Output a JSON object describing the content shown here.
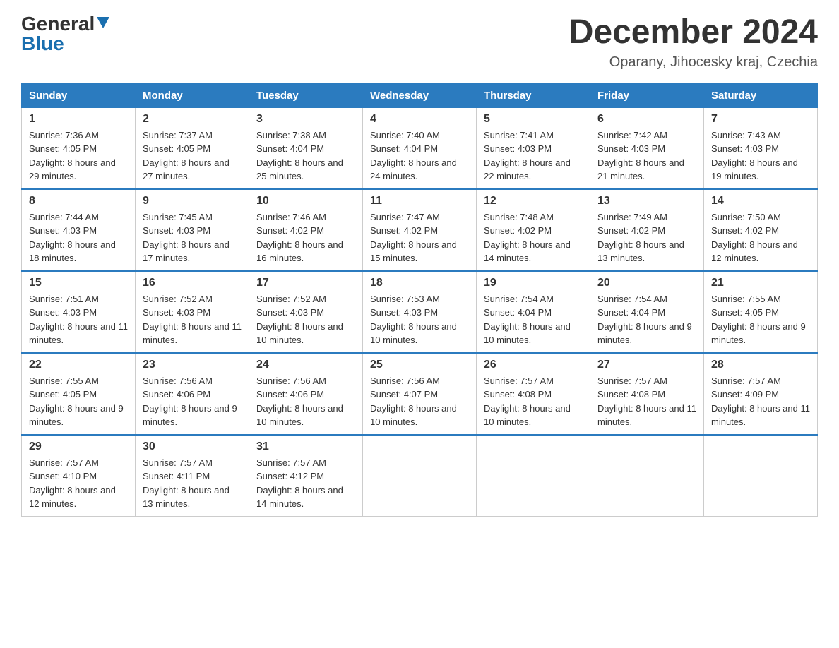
{
  "header": {
    "logo_general": "General",
    "logo_blue": "Blue",
    "month_year": "December 2024",
    "location": "Oparany, Jihocesky kraj, Czechia"
  },
  "days_of_week": [
    "Sunday",
    "Monday",
    "Tuesday",
    "Wednesday",
    "Thursday",
    "Friday",
    "Saturday"
  ],
  "weeks": [
    [
      {
        "day": "1",
        "sunrise": "7:36 AM",
        "sunset": "4:05 PM",
        "daylight": "8 hours and 29 minutes."
      },
      {
        "day": "2",
        "sunrise": "7:37 AM",
        "sunset": "4:05 PM",
        "daylight": "8 hours and 27 minutes."
      },
      {
        "day": "3",
        "sunrise": "7:38 AM",
        "sunset": "4:04 PM",
        "daylight": "8 hours and 25 minutes."
      },
      {
        "day": "4",
        "sunrise": "7:40 AM",
        "sunset": "4:04 PM",
        "daylight": "8 hours and 24 minutes."
      },
      {
        "day": "5",
        "sunrise": "7:41 AM",
        "sunset": "4:03 PM",
        "daylight": "8 hours and 22 minutes."
      },
      {
        "day": "6",
        "sunrise": "7:42 AM",
        "sunset": "4:03 PM",
        "daylight": "8 hours and 21 minutes."
      },
      {
        "day": "7",
        "sunrise": "7:43 AM",
        "sunset": "4:03 PM",
        "daylight": "8 hours and 19 minutes."
      }
    ],
    [
      {
        "day": "8",
        "sunrise": "7:44 AM",
        "sunset": "4:03 PM",
        "daylight": "8 hours and 18 minutes."
      },
      {
        "day": "9",
        "sunrise": "7:45 AM",
        "sunset": "4:03 PM",
        "daylight": "8 hours and 17 minutes."
      },
      {
        "day": "10",
        "sunrise": "7:46 AM",
        "sunset": "4:02 PM",
        "daylight": "8 hours and 16 minutes."
      },
      {
        "day": "11",
        "sunrise": "7:47 AM",
        "sunset": "4:02 PM",
        "daylight": "8 hours and 15 minutes."
      },
      {
        "day": "12",
        "sunrise": "7:48 AM",
        "sunset": "4:02 PM",
        "daylight": "8 hours and 14 minutes."
      },
      {
        "day": "13",
        "sunrise": "7:49 AM",
        "sunset": "4:02 PM",
        "daylight": "8 hours and 13 minutes."
      },
      {
        "day": "14",
        "sunrise": "7:50 AM",
        "sunset": "4:02 PM",
        "daylight": "8 hours and 12 minutes."
      }
    ],
    [
      {
        "day": "15",
        "sunrise": "7:51 AM",
        "sunset": "4:03 PM",
        "daylight": "8 hours and 11 minutes."
      },
      {
        "day": "16",
        "sunrise": "7:52 AM",
        "sunset": "4:03 PM",
        "daylight": "8 hours and 11 minutes."
      },
      {
        "day": "17",
        "sunrise": "7:52 AM",
        "sunset": "4:03 PM",
        "daylight": "8 hours and 10 minutes."
      },
      {
        "day": "18",
        "sunrise": "7:53 AM",
        "sunset": "4:03 PM",
        "daylight": "8 hours and 10 minutes."
      },
      {
        "day": "19",
        "sunrise": "7:54 AM",
        "sunset": "4:04 PM",
        "daylight": "8 hours and 10 minutes."
      },
      {
        "day": "20",
        "sunrise": "7:54 AM",
        "sunset": "4:04 PM",
        "daylight": "8 hours and 9 minutes."
      },
      {
        "day": "21",
        "sunrise": "7:55 AM",
        "sunset": "4:05 PM",
        "daylight": "8 hours and 9 minutes."
      }
    ],
    [
      {
        "day": "22",
        "sunrise": "7:55 AM",
        "sunset": "4:05 PM",
        "daylight": "8 hours and 9 minutes."
      },
      {
        "day": "23",
        "sunrise": "7:56 AM",
        "sunset": "4:06 PM",
        "daylight": "8 hours and 9 minutes."
      },
      {
        "day": "24",
        "sunrise": "7:56 AM",
        "sunset": "4:06 PM",
        "daylight": "8 hours and 10 minutes."
      },
      {
        "day": "25",
        "sunrise": "7:56 AM",
        "sunset": "4:07 PM",
        "daylight": "8 hours and 10 minutes."
      },
      {
        "day": "26",
        "sunrise": "7:57 AM",
        "sunset": "4:08 PM",
        "daylight": "8 hours and 10 minutes."
      },
      {
        "day": "27",
        "sunrise": "7:57 AM",
        "sunset": "4:08 PM",
        "daylight": "8 hours and 11 minutes."
      },
      {
        "day": "28",
        "sunrise": "7:57 AM",
        "sunset": "4:09 PM",
        "daylight": "8 hours and 11 minutes."
      }
    ],
    [
      {
        "day": "29",
        "sunrise": "7:57 AM",
        "sunset": "4:10 PM",
        "daylight": "8 hours and 12 minutes."
      },
      {
        "day": "30",
        "sunrise": "7:57 AM",
        "sunset": "4:11 PM",
        "daylight": "8 hours and 13 minutes."
      },
      {
        "day": "31",
        "sunrise": "7:57 AM",
        "sunset": "4:12 PM",
        "daylight": "8 hours and 14 minutes."
      },
      null,
      null,
      null,
      null
    ]
  ]
}
